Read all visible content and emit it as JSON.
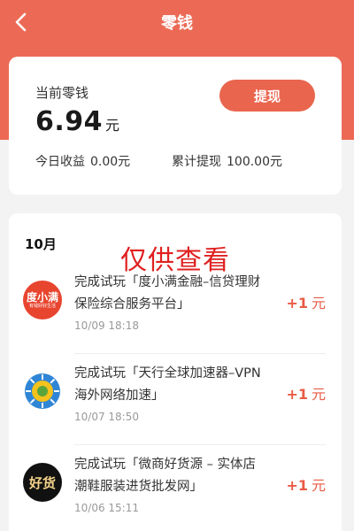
{
  "colors": {
    "accent": "#ec6a55",
    "button": "#e9654e",
    "reward": "#e95a44"
  },
  "header": {
    "title": "零钱",
    "back_icon": "chevron-left-icon"
  },
  "balance": {
    "label": "当前零钱",
    "value": "6.94",
    "unit": "元",
    "withdraw_label": "提现",
    "today_label": "今日收益",
    "today_value": "0.00元",
    "total_label": "累计提现",
    "total_value": "100.00元"
  },
  "records": {
    "month": "10月",
    "watermark": "仅供查看",
    "items": [
      {
        "text": "完成试玩「度小满金融–信贷理财保险综合服务平台」",
        "date": "10/09 18:18",
        "reward": "+1",
        "reward_unit": "元",
        "logo_text": "度小满",
        "logo_subtext": "有钱好好生活"
      },
      {
        "text": "完成试玩「天行全球加速器–VPN海外网络加速」",
        "date": "10/07 18:50",
        "reward": "+1",
        "reward_unit": "元"
      },
      {
        "text": "完成试玩「微商好货源 – 实体店潮鞋服装进货批发网」",
        "date": "10/06 15:11",
        "reward": "+1",
        "reward_unit": "元",
        "logo_text": "好货"
      }
    ]
  }
}
